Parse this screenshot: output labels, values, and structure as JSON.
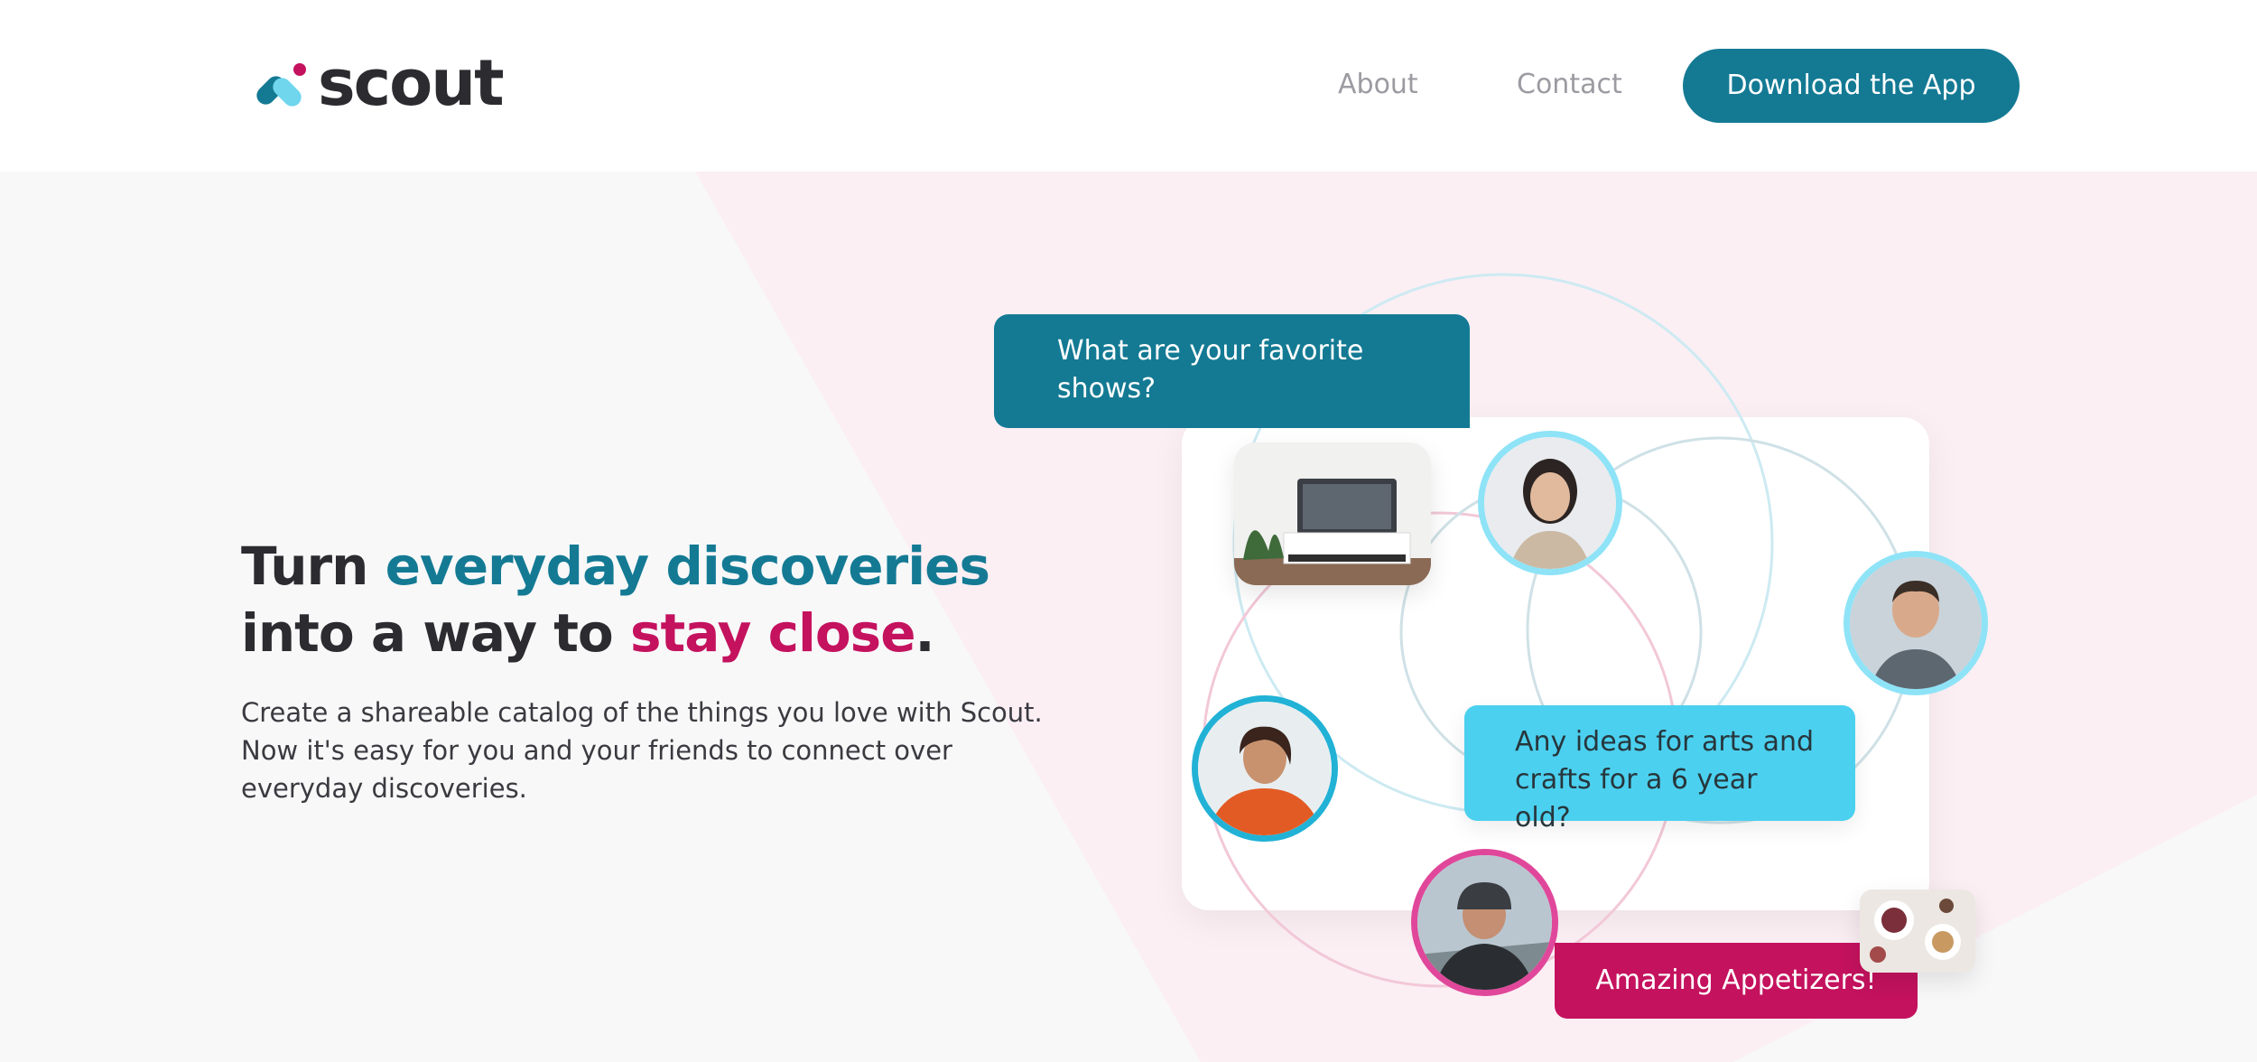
{
  "brand": {
    "name": "scout",
    "colors": {
      "teal": "#147a94",
      "pink": "#c4125e",
      "cyan": "#4cd0ef",
      "text": "#2b2b30"
    }
  },
  "nav": {
    "links": [
      "About",
      "Contact"
    ],
    "cta_label": "Download the App"
  },
  "hero": {
    "headline": {
      "part1": "Turn ",
      "highlight1": "everyday discoveries",
      "part2": " into a way to ",
      "highlight2": "stay close",
      "part3": "."
    },
    "subtext": "Create a shareable catalog of the things you love with Scout. Now it's easy for you and your friends to connect over everyday discoveries."
  },
  "illustration": {
    "bubbles": {
      "shows": "What are your favorite shows?",
      "arts": "Any ideas for arts and crafts for a 6 year old?",
      "appetizers": "Amazing Appetizers!"
    },
    "icons": [
      "scout-logo-icon",
      "tv-room-photo",
      "woman-portrait-avatar",
      "man-portrait-avatar",
      "woman-orange-sweater-avatar",
      "cyclist-avatar",
      "appetizers-photo"
    ]
  }
}
